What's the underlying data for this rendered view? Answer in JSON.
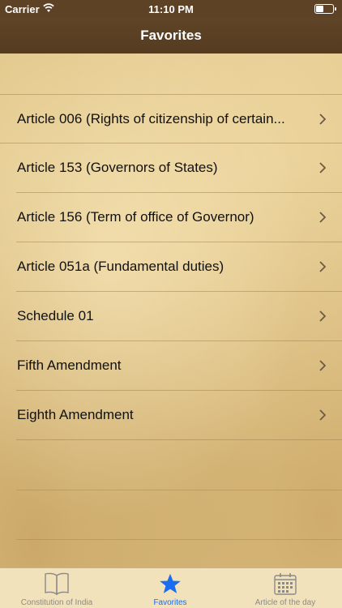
{
  "status_bar": {
    "carrier": "Carrier",
    "time": "11:10 PM"
  },
  "nav": {
    "title": "Favorites"
  },
  "favorites": [
    {
      "label": "Article 006 (Rights of citizenship of certain..."
    },
    {
      "label": "Article 153 (Governors of States)"
    },
    {
      "label": "Article 156 (Term of office of Governor)"
    },
    {
      "label": "Article 051a (Fundamental duties)"
    },
    {
      "label": "Schedule 01"
    },
    {
      "label": "Fifth Amendment"
    },
    {
      "label": "Eighth Amendment"
    }
  ],
  "tabs": [
    {
      "label": "Constitution of India",
      "icon": "book-icon",
      "active": false
    },
    {
      "label": "Favorites",
      "icon": "star-icon",
      "active": true
    },
    {
      "label": "Article of the day",
      "icon": "calendar-icon",
      "active": false
    }
  ],
  "colors": {
    "nav_bg": "#5d4226",
    "tab_active": "#1a6cf0",
    "tab_inactive": "#8a8a8a"
  }
}
